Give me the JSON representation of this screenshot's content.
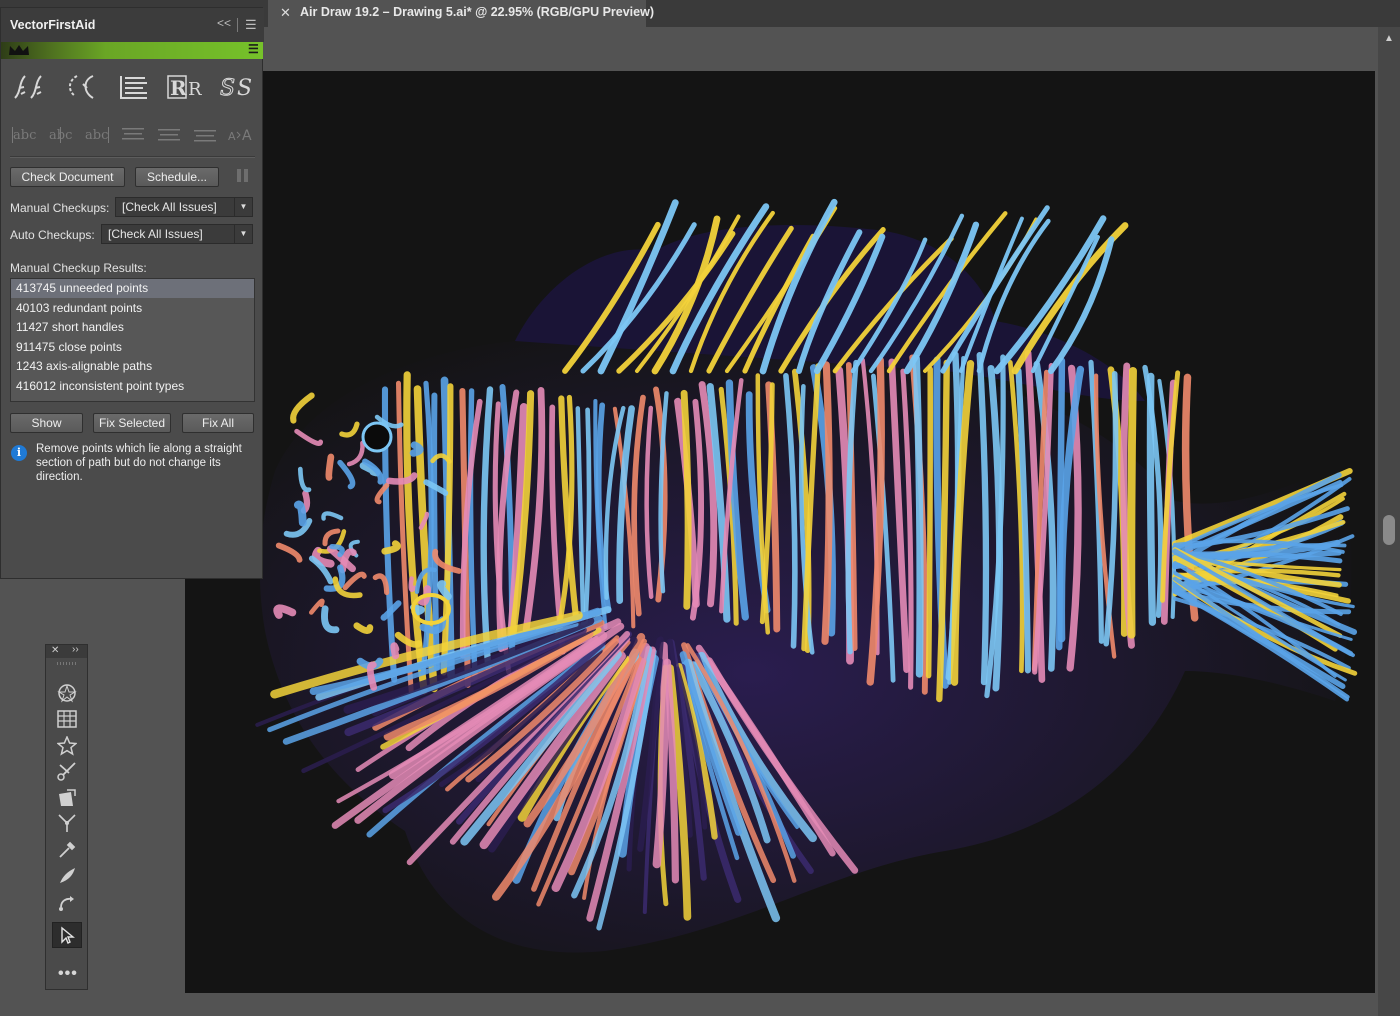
{
  "document": {
    "close_glyph": "✕",
    "tab_title": "Air Draw 19.2 – Drawing 5.ai* @ 22.95% (RGB/GPU Preview)"
  },
  "panel": {
    "title": "VectorFirstAid",
    "collapse_glyph": "<<",
    "menu_glyph": "☰",
    "tool_icons_row1": [
      "smooth-path-icon",
      "simplify-path-icon",
      "align-text-icon",
      "replace-glyph-icon",
      "style-swap-icon"
    ],
    "tool_icons_row2": [
      "text-left-icon",
      "text-center-icon",
      "text-right-icon",
      "align-top-icon",
      "align-middle-icon",
      "align-bottom-icon",
      "text-resize-icon"
    ],
    "check_document_label": "Check Document",
    "schedule_label": "Schedule...",
    "manual_checkups_label": "Manual Checkups:",
    "manual_checkups_value": "[Check All Issues]",
    "auto_checkups_label": "Auto Checkups:",
    "auto_checkups_value": "[Check All Issues]",
    "results_label": "Manual Checkup Results:",
    "results": [
      "413745 unneeded points",
      "40103 redundant points",
      "11427 short handles",
      "911475 close points",
      "1243 axis-alignable paths",
      "416012 inconsistent point types"
    ],
    "selected_result_index": 0,
    "show_label": "Show",
    "fix_selected_label": "Fix Selected",
    "fix_all_label": "Fix All",
    "info_glyph": "i",
    "info_text": "Remove points which lie along a straight section of path but do not change its direction."
  },
  "tools_palette": {
    "close_glyph": "✕",
    "expand_glyph": "››",
    "tools": [
      "symbol-sprayer-icon",
      "grid-icon",
      "star-icon",
      "scissors-icon",
      "free-transform-icon",
      "width-tool-icon",
      "eyedropper-icon",
      "blob-brush-icon",
      "rotate-icon",
      "selection-arrow-icon"
    ],
    "active_tool": "selection-arrow-icon",
    "more_glyph": "•••"
  },
  "artwork": {
    "subject": "lionfish-illustration",
    "background": "#141414",
    "palette": [
      "#7cc6f4",
      "#5aa3e8",
      "#f2d23a",
      "#f08a6b",
      "#e48bb6",
      "#3b2a6e",
      "#2a1d4f"
    ]
  },
  "colors": {
    "accent_green": "#76c22a",
    "selection_row": "#6d7079",
    "info_blue": "#1f7ad6"
  }
}
